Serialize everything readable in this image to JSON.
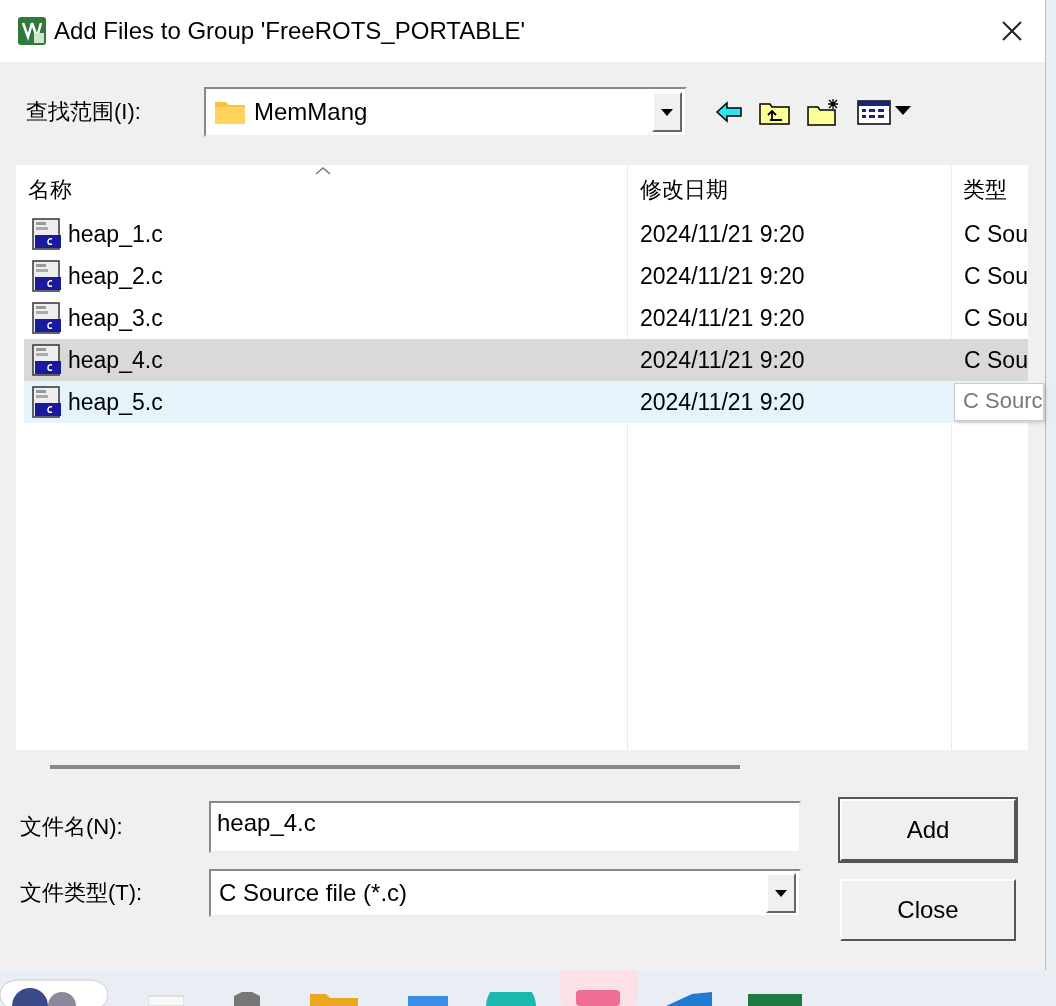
{
  "window": {
    "title": "Add Files to Group 'FreeROTS_PORTABLE'"
  },
  "look_in": {
    "label": "查找范围(I):",
    "value": "MemMang"
  },
  "list": {
    "columns": [
      "名称",
      "修改日期",
      "类型"
    ],
    "rows": [
      {
        "name": "heap_1.c",
        "date": "2024/11/21 9:20",
        "type": "C Sou",
        "selected": false,
        "hovered": false
      },
      {
        "name": "heap_2.c",
        "date": "2024/11/21 9:20",
        "type": "C Sou",
        "selected": false,
        "hovered": false
      },
      {
        "name": "heap_3.c",
        "date": "2024/11/21 9:20",
        "type": "C Sou",
        "selected": false,
        "hovered": false
      },
      {
        "name": "heap_4.c",
        "date": "2024/11/21 9:20",
        "type": "C Sou",
        "selected": true,
        "hovered": false
      },
      {
        "name": "heap_5.c",
        "date": "2024/11/21 9:20",
        "selected": false,
        "hovered": true
      }
    ],
    "tooltip": "C Sourc"
  },
  "file_name": {
    "label": "文件名(N):",
    "value": "heap_4.c"
  },
  "file_type": {
    "label": "文件类型(T):",
    "value": "C Source file (*.c)"
  },
  "buttons": [
    "Add",
    "Close"
  ]
}
